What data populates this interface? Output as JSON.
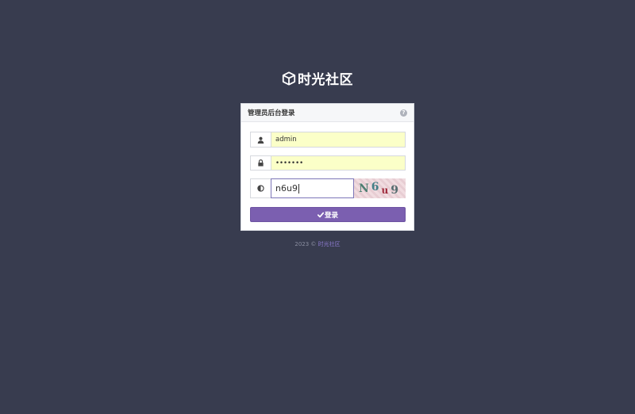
{
  "brand": {
    "title": "时光社区",
    "icon": "cube-icon"
  },
  "panel": {
    "title": "管理员后台登录",
    "help_icon": "question-circle-icon"
  },
  "login_form": {
    "username": {
      "icon": "user-icon",
      "value": "admin"
    },
    "password": {
      "icon": "lock-icon",
      "value": "•••••••"
    },
    "captcha": {
      "icon": "half-circle-icon",
      "value": "n6u9",
      "image_text": [
        "N",
        "6",
        "u",
        "9"
      ]
    },
    "submit_label": "登录",
    "submit_icon": "check-icon"
  },
  "footer": {
    "copyright": "2023 ©",
    "link_text": "时光社区"
  },
  "colors": {
    "background": "#383c4f",
    "accent": "#7b5fb0",
    "autofill": "#fbffc8"
  }
}
